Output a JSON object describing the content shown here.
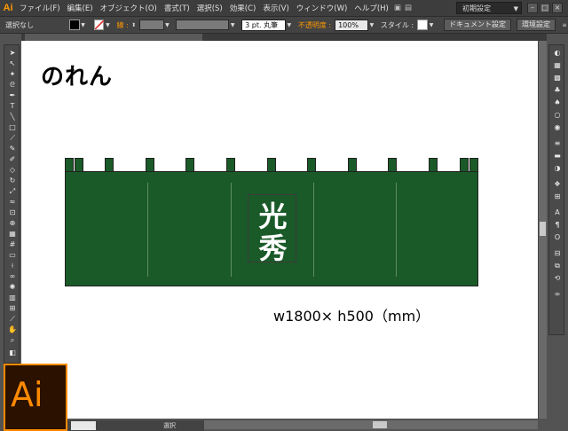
{
  "app": {
    "logo": "Ai"
  },
  "menubar": {
    "items": [
      "ファイル(F)",
      "編集(E)",
      "オブジェクト(O)",
      "書式(T)",
      "選択(S)",
      "効果(C)",
      "表示(V)",
      "ウィンドウ(W)",
      "ヘルプ(H)"
    ],
    "workspace": "初期設定"
  },
  "controlbar": {
    "selection_label": "選択なし",
    "stroke_label": "線 :",
    "stroke_profile": "3 pt. 丸筆",
    "opacity_label": "不透明度 :",
    "opacity_value": "100%",
    "style_label": "スタイル :",
    "doc_setup_button": "ドキュメント設定",
    "prefs_button": "環境設定",
    "colors": {
      "fill": "#000000",
      "stroke": "#ffffff",
      "accent": "#ff9a00"
    }
  },
  "document": {
    "title": "のれん",
    "noren_text": "光秀",
    "dimensions": "w1800× h500（mm）",
    "colors": {
      "noren_green": "#1a5a28",
      "text": "#ffffff"
    }
  },
  "statusbar": {
    "zoom": "",
    "status": "選択"
  },
  "badge": {
    "text": "Ai"
  },
  "icons": {
    "toolbar": [
      "selection-icon",
      "direct-selection-icon",
      "magic-wand-icon",
      "lasso-icon",
      "pen-icon",
      "type-icon",
      "line-icon",
      "rectangle-icon",
      "paintbrush-icon",
      "pencil-icon",
      "blob-brush-icon",
      "eraser-icon",
      "rotate-icon",
      "scale-icon",
      "warp-icon",
      "free-transform-icon",
      "shape-builder-icon",
      "perspective-icon",
      "mesh-icon",
      "gradient-icon",
      "eyedropper-icon",
      "blend-icon",
      "symbol-sprayer-icon",
      "graph-icon",
      "artboard-icon",
      "slice-icon",
      "hand-icon",
      "zoom-icon"
    ],
    "dock": [
      "color-icon",
      "color-guide-icon",
      "swatches-icon",
      "brushes-icon",
      "symbols-icon",
      "graphic-styles-icon",
      "stroke-icon",
      "gradient-panel-icon",
      "transparency-icon",
      "appearance-icon",
      "layers-icon",
      "artboards-icon",
      "character-icon",
      "paragraph-icon",
      "opentype-icon",
      "align-icon",
      "pathfinder-icon",
      "transform-icon"
    ]
  }
}
